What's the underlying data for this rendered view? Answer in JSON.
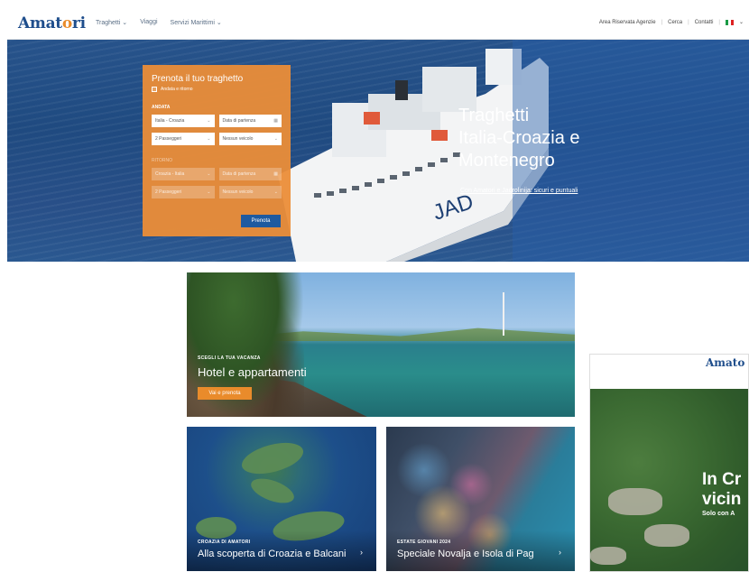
{
  "header": {
    "logo_prefix": "Amat",
    "logo_o": "o",
    "logo_suffix": "ri",
    "nav": [
      "Traghetti ⌄",
      "Viaggi",
      "Servizi Marittimi ⌄"
    ],
    "right_links": [
      "Area Riservata Agenzie",
      "Cerca",
      "Contatti"
    ],
    "lang_icon": "italian-flag-icon",
    "lang_chevron": "⌄"
  },
  "hero": {
    "title": "Traghetti\nItalia-Croazia e\nMontenegro",
    "subtitle": "Con Amatori e Jadrolinija: sicuri e puntuali",
    "ship_name_fragment": "JAD"
  },
  "booking": {
    "title": "Prenota il tuo traghetto",
    "roundtrip_label": "Andata e ritorno",
    "outbound_label": "ANDATA",
    "outbound_route": "Italia - Croazia",
    "outbound_date_placeholder": "Data di partenza",
    "outbound_passengers": "2 Passeggeri",
    "outbound_vehicle": "Nessun veicolo",
    "return_label": "RITORNO",
    "return_route": "Croazia - Italia",
    "return_date_placeholder": "Data di partenza",
    "return_passengers": "2 Passeggeri",
    "return_vehicle": "Nessun veicolo",
    "submit": "Prenota"
  },
  "cards": [
    {
      "kicker": "SCEGLI LA TUA VACANZA",
      "title": "Hotel e appartamenti",
      "cta": "Vai e prenota"
    },
    {
      "kicker": "CROAZIA DI AMATORI",
      "title": "Alla scoperta di Croazia e Balcani",
      "arrow": "›"
    },
    {
      "kicker": "ESTATE GIOVANI 2024",
      "title": "Speciale Novalja e Isola di Pag",
      "arrow": "›"
    }
  ],
  "ad": {
    "logo": "Amato",
    "headline": "In Cr\nvicin",
    "sub": "Solo con A"
  },
  "colors": {
    "brand_blue": "#1f4e8c",
    "accent_orange": "#e98b2b",
    "button_blue": "#1e5aa0"
  }
}
